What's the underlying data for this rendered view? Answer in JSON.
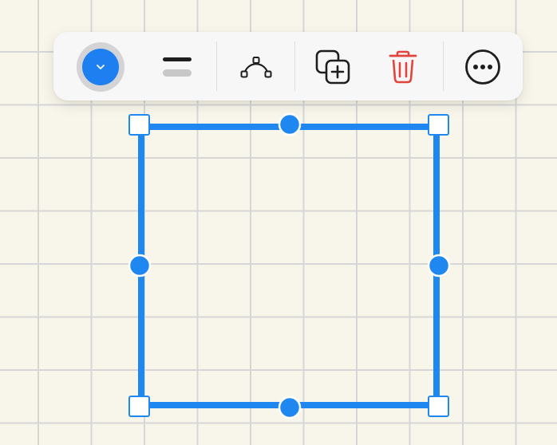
{
  "canvas": {
    "background": "#f8f6ea",
    "grid_color": "#d6d6d6"
  },
  "toolbar": {
    "color_picker": {
      "icon": "chevron-down-icon",
      "selected_color": "#1e7ff0"
    },
    "stroke_style": {
      "icon": "stroke-width-icon"
    },
    "edit_path": {
      "icon": "bezier-curve-icon"
    },
    "duplicate": {
      "icon": "duplicate-icon"
    },
    "delete": {
      "icon": "trash-icon",
      "color": "#e0443c"
    },
    "more": {
      "icon": "ellipsis-circle-icon"
    }
  },
  "selection": {
    "shape": "rectangle",
    "stroke_color": "#1f88f0",
    "handle_fill": "#ffffff",
    "midpoint_fill": "#1f88f0"
  }
}
